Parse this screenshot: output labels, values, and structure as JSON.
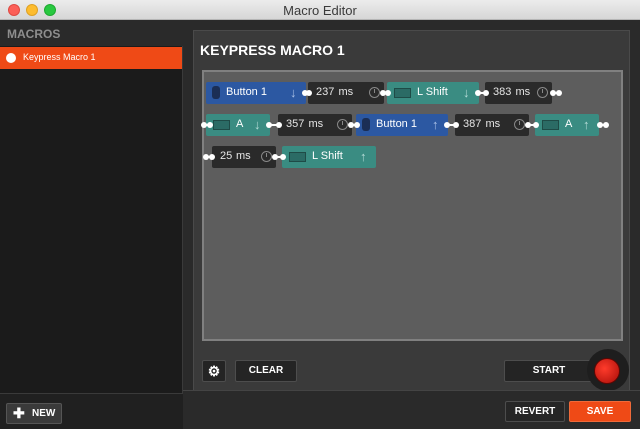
{
  "window": {
    "title": "Macro Editor"
  },
  "sidebar": {
    "title": "MACROS",
    "items": [
      {
        "label": "Keypress Macro 1",
        "selected": true
      }
    ],
    "new_label": "NEW"
  },
  "editor": {
    "macro_title": "KEYPRESS MACRO 1",
    "steps": [
      {
        "type": "mouse",
        "label": "Button 1",
        "direction": "down"
      },
      {
        "type": "delay",
        "label": "237",
        "unit": "ms"
      },
      {
        "type": "key",
        "label": "L Shift",
        "direction": "down"
      },
      {
        "type": "delay",
        "label": "383",
        "unit": "ms"
      },
      {
        "type": "key",
        "label": "A",
        "direction": "down"
      },
      {
        "type": "delay",
        "label": "357",
        "unit": "ms"
      },
      {
        "type": "mouse",
        "label": "Button 1",
        "direction": "up"
      },
      {
        "type": "delay",
        "label": "387",
        "unit": "ms"
      },
      {
        "type": "key",
        "label": "A",
        "direction": "up"
      },
      {
        "type": "delay",
        "label": "25",
        "unit": "ms"
      },
      {
        "type": "key",
        "label": "L Shift",
        "direction": "up"
      }
    ],
    "clear_label": "CLEAR",
    "start_label": "START"
  },
  "footer": {
    "revert_label": "REVERT",
    "save_label": "SAVE"
  },
  "colors": {
    "accent": "#ef4a16",
    "mouse_block": "#2c58a2",
    "key_block": "#3a8c82",
    "delay_block": "#2a2a2a",
    "record": "#d51d12"
  },
  "icons": {
    "mouse": "mouse-icon",
    "key": "keyboard-icon",
    "delay": "clock-icon",
    "down": "arrow-down-icon",
    "up": "arrow-up-icon",
    "settings": "gear-icon",
    "new": "plus-icon"
  }
}
